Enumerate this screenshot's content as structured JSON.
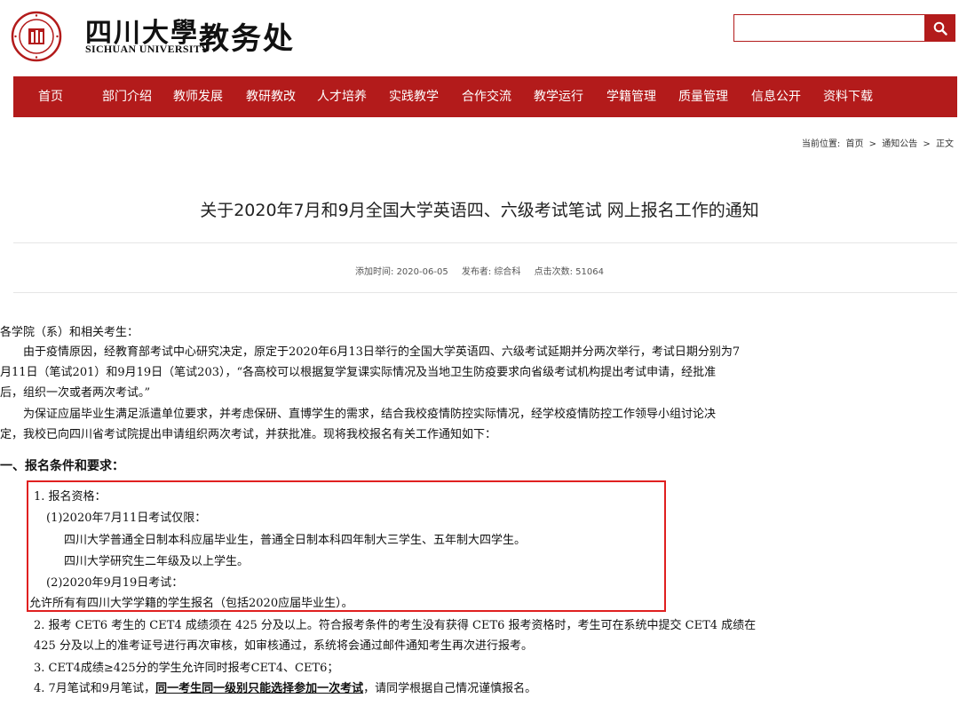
{
  "header": {
    "logo_cn": "四川大學",
    "logo_en": "SICHUAN UNIVERSITY",
    "dept": "教务处",
    "search_placeholder": ""
  },
  "nav": {
    "items": [
      "首页",
      "部门介绍",
      "教师发展",
      "教研教改",
      "人才培养",
      "实践教学",
      "合作交流",
      "教学运行",
      "学籍管理",
      "质量管理",
      "信息公开",
      "资料下载"
    ]
  },
  "breadcrumb": {
    "label": "当前位置:",
    "items": [
      "首页",
      ">",
      "通知公告",
      ">",
      "正文"
    ]
  },
  "article": {
    "title": "关于2020年7月和9月全国大学英语四、六级考试笔试 网上报名工作的通知",
    "meta_time": "添加时间: 2020-06-05",
    "meta_author": "发布者: 综合科",
    "meta_clicks": "点击次数: 51064",
    "lines": [
      "各学院（系）和相关考生：",
      "　　由于疫情原因，经教育部考试中心研究决定，原定于2020年6月13日举行的全国大学英语四、六级考试延期并分两次举行，考试日期分别为7",
      "月11日（笔试201）和9月19日（笔试203），“各高校可以根据复学复课实际情况及当地卫生防疫要求向省级考试机构提出考试申请，经批准",
      "后，组织一次或者两次考试。”",
      "　　为保证应届毕业生满足派遣单位要求，并考虑保研、直博学生的需求，结合我校疫情防控实际情况，经学校疫情防控工作领导小组讨论决",
      "定，我校已向四川省考试院提出申请组织两次考试，并获批准。现将我校报名有关工作通知如下：",
      "一、报名条件和要求：",
      "1. 报名资格：",
      "(1)2020年7月11日考试仅限：",
      "四川大学普通全日制本科应届毕业生，普通全日制本科四年制大三学生、五年制大四学生。",
      "四川大学研究生二年级及以上学生。",
      "(2)2020年9月19日考试：",
      "允许所有有四川大学学籍的学生报名（包括2020应届毕业生）。",
      "2. 报考 CET6 考生的 CET4 成绩须在 425 分及以上。符合报考条件的考生没有获得 CET6 报考资格时，考生可在系统中提交 CET4 成绩在",
      "425 分及以上的准考证号进行再次审核，如审核通过，系统将会通过邮件通知考生再次进行报考。",
      "3. CET4成绩≥425分的学生允许同时报考CET4、CET6；"
    ],
    "line4_pre": "4. 7月笔试和9月笔试，",
    "line4_bold": "同一考生同一级别只能选择参加一次考试",
    "line4_post": "，请同学根据自己情况谨慎报名。"
  },
  "colors": {
    "brand": "#b31b1b",
    "highlight_box": "#e02020"
  },
  "icons": {
    "search": "search-icon",
    "logo": "university-seal-icon"
  }
}
